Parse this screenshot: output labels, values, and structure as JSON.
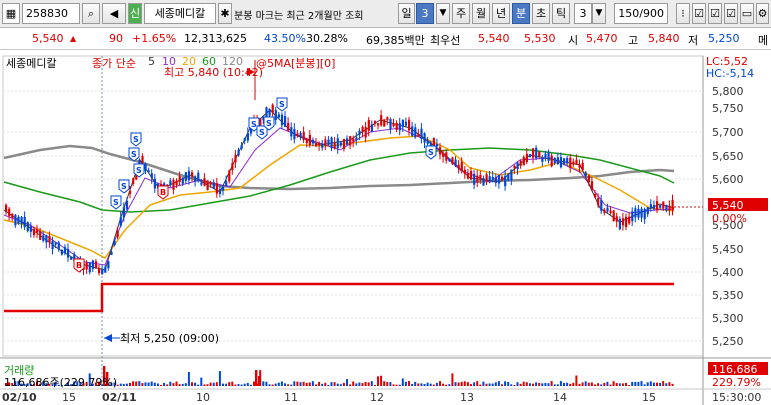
{
  "toolbar": {
    "code": "258830",
    "stock_name": "세종메디칼",
    "notice": "분봉 마크는 최근 2개월만 조회",
    "period_options": [
      "일",
      "주",
      "월",
      "년",
      "분",
      "초",
      "틱"
    ],
    "day_label": "일",
    "day_value": "3",
    "week_label": "주",
    "month_label": "월",
    "year_label": "년",
    "minute_label": "분",
    "second_label": "초",
    "tick_label": "틱",
    "interval_value": "3",
    "count_value": "150/900",
    "buy_icon": "신"
  },
  "info": {
    "price": "5,540",
    "change": "90",
    "change_pct": "+1.65%",
    "volume": "12,313,625",
    "ratio1": "43.50%",
    "ratio2": "30.28%",
    "amount": "69,385백만",
    "priority_label": "최우선",
    "ask": "5,540",
    "bid": "5,530",
    "open_label": "시",
    "open": "5,470",
    "high_label": "고",
    "high": "5,840",
    "low_label": "저",
    "low": "5,250",
    "extra": "메"
  },
  "legend": {
    "stock": "세종메디칼",
    "price_label": "종가 단순",
    "ma1": "5",
    "ma2": "10",
    "ma3": "20",
    "ma4": "60",
    "ma5": "120",
    "ma_extra": "@5MA[분봉][0]",
    "lc": "LC:5,52",
    "hc": "HC:-5,14"
  },
  "annotations": {
    "high_note": "최고 5,840 (10:42)",
    "low_note": "최저 5,250 (09:00)"
  },
  "price_axis": {
    "labels": [
      "5,800",
      "5,750",
      "5,700",
      "5,650",
      "5,600",
      "5,550",
      "5,500",
      "5,450",
      "5,400",
      "5,350",
      "5,300",
      "5,250"
    ],
    "current": "5,540",
    "current_pct": "0.00%"
  },
  "volume": {
    "label": "거래량",
    "value": "116,686주(229.79%)",
    "axis_value": "116,686",
    "axis_pct": "229.79%"
  },
  "time_axis": {
    "labels": [
      "02/10",
      "15",
      "02/11",
      "10",
      "11",
      "12",
      "13",
      "14",
      "15",
      "15:30:00"
    ]
  },
  "colors": {
    "up": "#e00000",
    "down": "#0047d6",
    "ma5": "#3a3a3a",
    "ma10": "#8e2bd8",
    "ma20": "#f0a500",
    "ma60": "#1a9a1a",
    "ma120": "#8a8a8a",
    "accent": "#4a78c2"
  }
}
